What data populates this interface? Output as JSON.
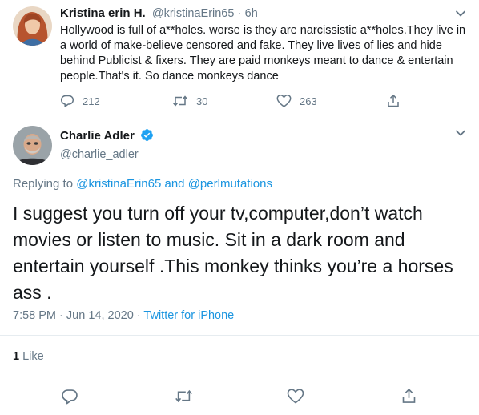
{
  "reply_tweet": {
    "author_name": "Kristina erin H.",
    "author_handle": "@kristinaErin65",
    "separator": "·",
    "age": "6h",
    "text": "Hollywood is full of a**holes.  worse is they are narcissistic a**holes.They live in a world of make-believe censored and fake. They live lives of lies and hide behind Publicist & fixers. They are paid monkeys meant to dance & entertain people.That's it. So dance monkeys dance",
    "reply_count": "212",
    "retweet_count": "30",
    "like_count": "263"
  },
  "main_tweet": {
    "author_name": "Charlie Adler",
    "author_handle": "@charlie_adler",
    "replying_prefix": "Replying to",
    "replying_user1": "@kristinaErin65",
    "replying_and": "and",
    "replying_user2": "@perlmutations",
    "text": "I suggest you turn off your tv,computer,don’t watch movies or listen to music. Sit in a dark room and entertain yourself .This monkey thinks you’re a horses ass .",
    "time": "7:58 PM",
    "date_sep": "·",
    "date": "Jun 14, 2020",
    "source_sep": "·",
    "source": "Twitter for iPhone",
    "likes_number": "1",
    "likes_label": "Like"
  },
  "colors": {
    "accent": "#1b95e0",
    "verified": "#1da1f2",
    "muted": "#657786",
    "divider": "#e6ecf0"
  }
}
